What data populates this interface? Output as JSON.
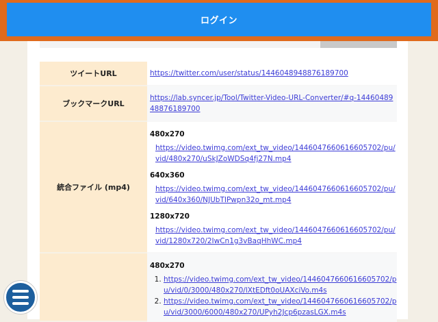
{
  "header": {
    "login_label": "ログイン"
  },
  "table": {
    "tweet_url": {
      "label": "ツイートURL",
      "value": "https://twitter.com/user/status/1446048948876189700"
    },
    "bookmark_url": {
      "label": "ブックマークURL",
      "value": "https://lab.syncer.jp/Tool/Twitter-Video-URL-Converter/#q-1446048948876189700"
    },
    "combined_file": {
      "label": "統合ファイル (mp4)",
      "entries": [
        {
          "resolution": "480x270",
          "url": "https://video.twimg.com/ext_tw_video/1446047660616605702/pu/vid/480x270/uSkJZoWDSq4fj27N.mp4"
        },
        {
          "resolution": "640x360",
          "url": "https://video.twimg.com/ext_tw_video/1446047660616605702/pu/vid/640x360/NJUbTIPwpn32o_mt.mp4"
        },
        {
          "resolution": "1280x720",
          "url": "https://video.twimg.com/ext_tw_video/1446047660616605702/pu/vid/1280x720/2IwCn1g3vBaqHhWC.mp4"
        }
      ]
    },
    "segments": {
      "resolution": "480x270",
      "items": [
        "https://video.twimg.com/ext_tw_video/1446047660616605702/pu/vid/0/3000/480x270/lXtEDft0oUAXciVo.m4s",
        "https://video.twimg.com/ext_tw_video/1446047660616605702/pu/vid/3000/6000/480x270/UPyh2Jcp6pzasLGX.m4s"
      ]
    }
  },
  "fab": {
    "icon": "hamburger-menu-icon"
  }
}
